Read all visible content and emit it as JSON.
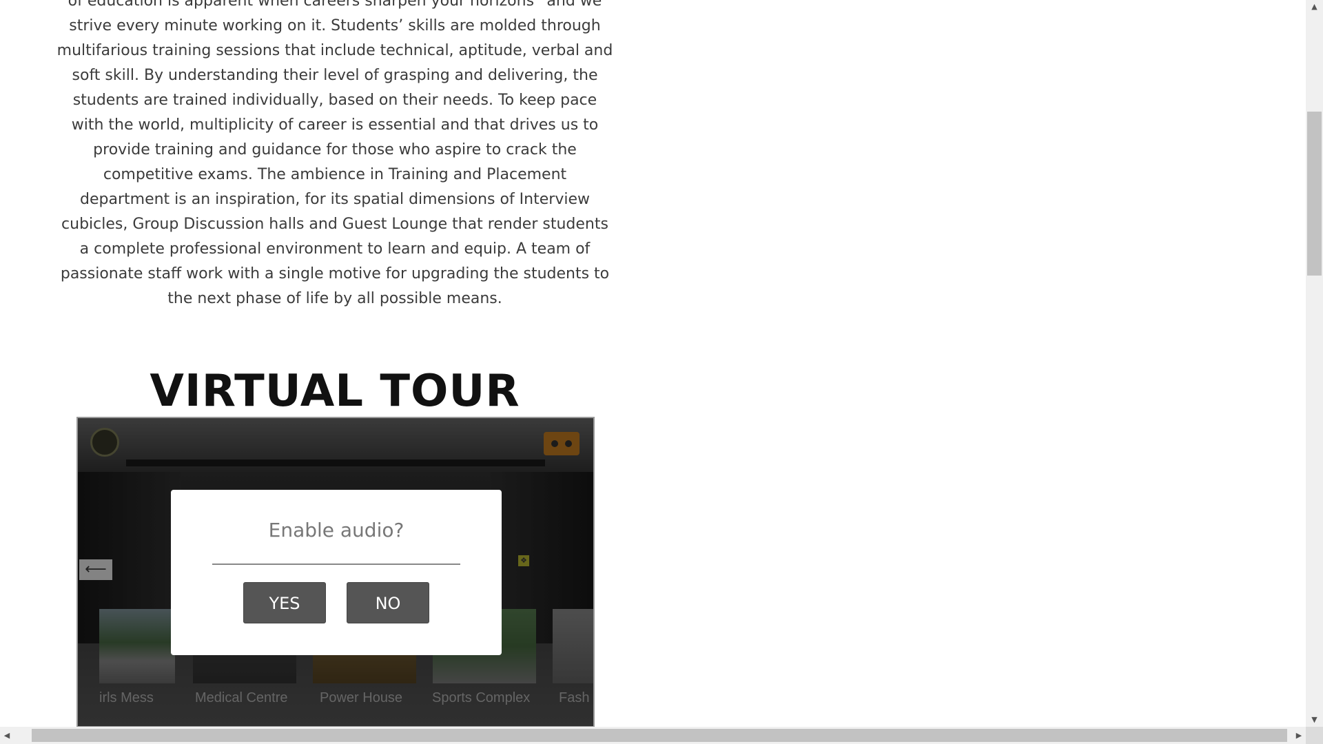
{
  "paragraph": {
    "lines": [
      "of education is apparent when careers sharpen your horizons” and we",
      "strive every minute working on it. Students’ skills are molded through",
      "multifarious training sessions that include technical, aptitude, verbal and",
      "soft skill. By understanding their level of grasping and delivering, the",
      "students are trained individually, based on their needs. To keep pace",
      "with the world, multiplicity of career is essential and that drives us to",
      "provide training and guidance for those who aspire to crack the",
      "competitive exams. The ambience in Training and Placement",
      "department is an inspiration, for its spatial dimensions of Interview",
      "cubicles, Group Discussion halls and Guest Lounge that render students",
      "a complete professional environment to learn and equip. A team of",
      "passionate staff work with a single motive for upgrading the students to",
      "the next phase of life by all possible means."
    ]
  },
  "virtual_tour": {
    "heading": "VIRTUAL TOUR",
    "thumbnails": [
      "irls Mess",
      "Medical Centre",
      "Power House",
      "Sports Complex",
      "Fash"
    ],
    "dialog": {
      "title": "Enable audio?",
      "yes_label": "YES",
      "no_label": "NO"
    },
    "icons": {
      "logo": "college-logo-icon",
      "vr": "vr-headset-icon",
      "arrow": "left-arrow-icon"
    }
  },
  "scrollbars": {
    "up": "▲",
    "down": "▼",
    "left": "◀",
    "right": "▶"
  },
  "colors": {
    "text": "#3b3b3b",
    "heading": "#111111",
    "dialog_button": "#555555",
    "vr_button": "#a86a1c"
  }
}
